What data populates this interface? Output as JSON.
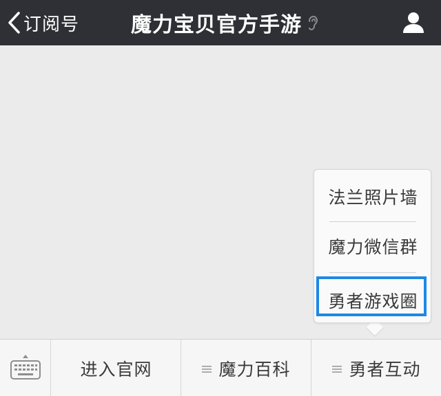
{
  "header": {
    "back_label": "订阅号",
    "title": "魔力宝贝官方手游"
  },
  "icons": {
    "back": "chevron-left-icon",
    "ear": "ear-icon",
    "profile": "person-icon",
    "keyboard": "keyboard-icon",
    "submenu": "menu-lines-icon"
  },
  "popup": {
    "items": [
      "法兰照片墙",
      "魔力微信群",
      "勇者游戏圈"
    ],
    "selected_index": 2
  },
  "menu": {
    "items": [
      {
        "label": "进入官网",
        "has_submenu": false
      },
      {
        "label": "魔力百科",
        "has_submenu": true
      },
      {
        "label": "勇者互动",
        "has_submenu": true
      }
    ]
  },
  "colors": {
    "header_bg": "#2e3035",
    "chat_bg": "#ebebeb",
    "highlight": "#1e88e5"
  }
}
